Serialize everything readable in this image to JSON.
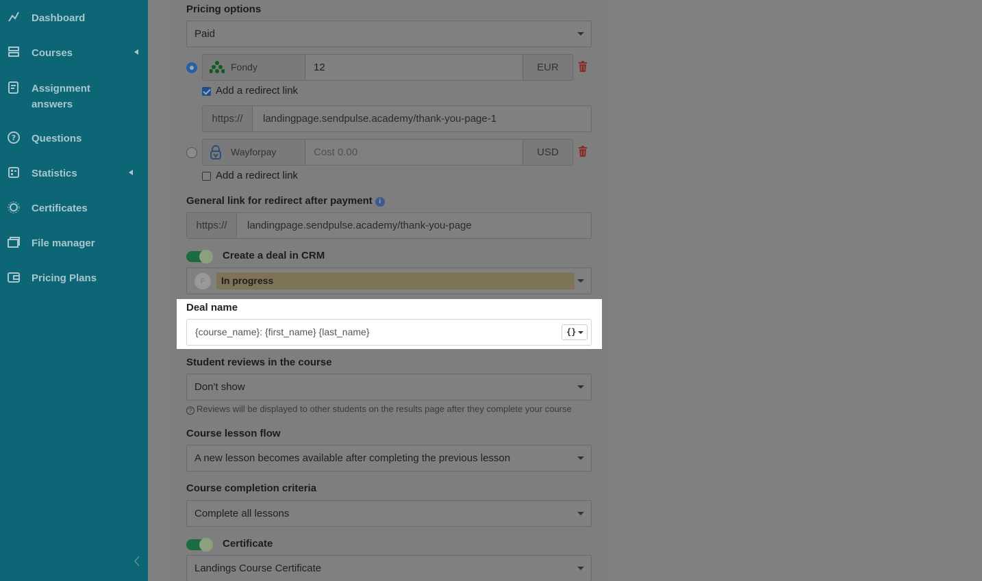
{
  "sidebar": {
    "items": [
      {
        "label": "Dashboard",
        "icon": "chart-line-icon"
      },
      {
        "label": "Courses",
        "icon": "courses-icon"
      },
      {
        "label": "Assignment answers",
        "icon": "assignment-icon"
      },
      {
        "label": "Questions",
        "icon": "question-icon"
      },
      {
        "label": "Statistics",
        "icon": "statistics-icon"
      },
      {
        "label": "Certificates",
        "icon": "certificate-icon"
      },
      {
        "label": "File manager",
        "icon": "folder-icon"
      },
      {
        "label": "Pricing Plans",
        "icon": "wallet-icon"
      }
    ]
  },
  "pricing": {
    "label": "Pricing options",
    "value": "Paid"
  },
  "payments": [
    {
      "provider": "Fondy",
      "amount": "12",
      "currency": "EUR",
      "selected": true,
      "redirect_label": "Add a redirect link",
      "redirect_checked": true,
      "redirect_prefix": "https://",
      "redirect_url": "landingpage.sendpulse.academy/thank-you-page-1"
    },
    {
      "provider": "Wayforpay",
      "amount_placeholder": "Cost 0.00",
      "currency": "USD",
      "selected": false,
      "redirect_label": "Add a redirect link",
      "redirect_checked": false
    }
  ],
  "general_redirect": {
    "label": "General link for redirect after payment",
    "prefix": "https://",
    "url": "landingpage.sendpulse.academy/thank-you-page"
  },
  "crm": {
    "toggle_label": "Create a deal in CRM",
    "avatar_letter": "F",
    "stage": "In progress"
  },
  "deal_name": {
    "label": "Deal name",
    "value": "{course_name}: {first_name} {last_name}",
    "var_button": "{}"
  },
  "reviews": {
    "label": "Student reviews in the course",
    "value": "Don't show",
    "hint": "Reviews will be displayed to other students on the results page after they complete your course"
  },
  "lesson_flow": {
    "label": "Course lesson flow",
    "value": "A new lesson becomes available after completing the previous lesson"
  },
  "completion": {
    "label": "Course completion criteria",
    "value": "Complete all lessons"
  },
  "certificate": {
    "toggle_label": "Certificate",
    "value": "Landings Course Certificate"
  }
}
